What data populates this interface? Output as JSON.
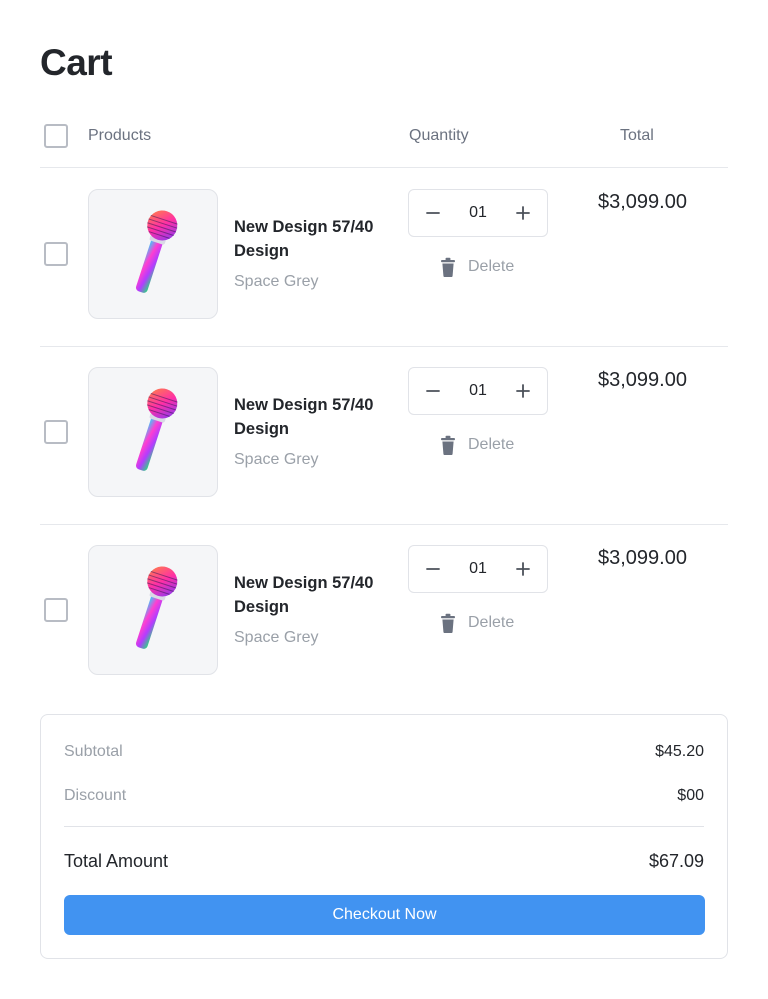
{
  "page": {
    "title": "Cart"
  },
  "table": {
    "headers": {
      "products": "Products",
      "quantity": "Quantity",
      "total": "Total"
    }
  },
  "items": [
    {
      "name": "New Design 57/40 Design",
      "variant": "Space Grey",
      "quantity": "01",
      "delete_label": "Delete",
      "price": "$3,099.00",
      "icon": "microphone-image"
    },
    {
      "name": "New Design 57/40 Design",
      "variant": "Space Grey",
      "quantity": "01",
      "delete_label": "Delete",
      "price": "$3,099.00",
      "icon": "microphone-image"
    },
    {
      "name": "New Design 57/40 Design",
      "variant": "Space Grey",
      "quantity": "01",
      "delete_label": "Delete",
      "price": "$3,099.00",
      "icon": "microphone-image"
    }
  ],
  "summary": {
    "subtotal_label": "Subtotal",
    "subtotal_value": "$45.20",
    "discount_label": "Discount",
    "discount_value": "$00",
    "total_label": "Total Amount",
    "total_value": "$67.09",
    "checkout_label": "Checkout Now"
  },
  "colors": {
    "accent": "#4193f1",
    "text": "#23262b",
    "muted": "#9aa0a8",
    "border": "#e1e3e8"
  },
  "icons": {
    "minus": "minus-icon",
    "plus": "plus-icon",
    "delete": "trash-icon"
  }
}
